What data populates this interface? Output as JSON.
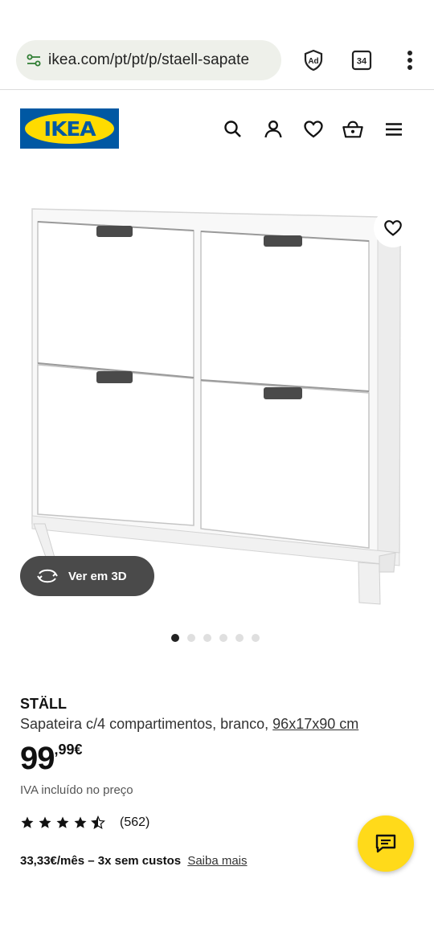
{
  "browser": {
    "url": "ikea.com/pt/pt/p/staell-sapate",
    "tab_count": "34",
    "adblock_label": "Ad"
  },
  "header": {
    "logo_text": "IKEA",
    "icons": [
      "search-icon",
      "user-icon",
      "heart-icon",
      "basket-icon",
      "menu-icon"
    ]
  },
  "gallery": {
    "view_3d_label": "Ver em 3D",
    "dots_total": 6,
    "dots_active": 1
  },
  "product": {
    "name": "STÄLL",
    "description": "Sapateira c/4 compartimentos, branco,",
    "dimensions": "96x17x90 cm",
    "price_integer": "99",
    "price_decimal": ",99€",
    "vat_note": "IVA incluído no preço",
    "rating_stars": 4.5,
    "rating_count": "(562)",
    "installment_text": "33,33€/mês – 3x sem custos",
    "installment_link": "Saiba mais"
  },
  "colors": {
    "ikea_blue": "#0058a3",
    "ikea_yellow": "#ffdb00",
    "chat_yellow": "#ffda1a"
  }
}
